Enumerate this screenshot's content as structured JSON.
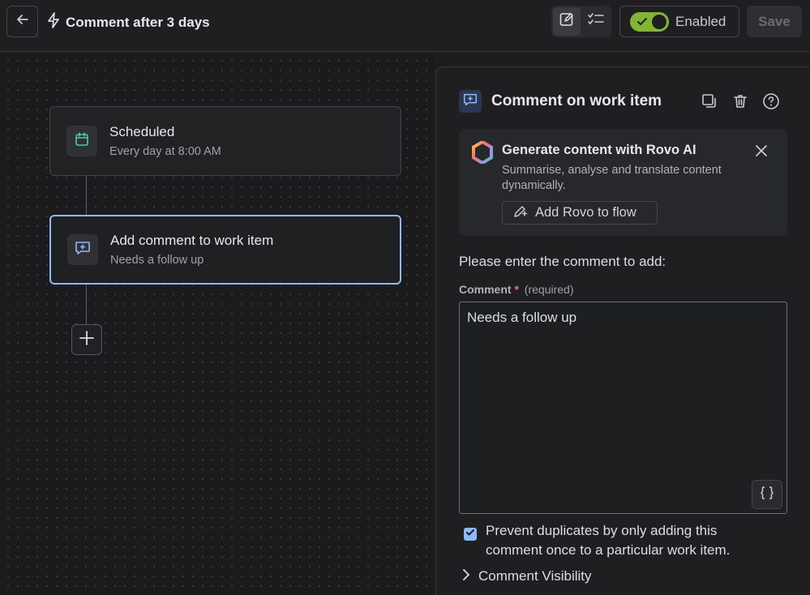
{
  "header": {
    "title": "Comment after 3 days",
    "enabled_label": "Enabled",
    "save_label": "Save",
    "toggle_on": true
  },
  "flow": {
    "nodes": [
      {
        "title": "Scheduled",
        "subtitle": "Every day at 8:00 AM",
        "icon": "calendar-icon",
        "color": "#4bce97"
      },
      {
        "title": "Add comment to work item",
        "subtitle": "Needs a follow up",
        "icon": "comment-add-icon",
        "color": "#8fb8f6"
      }
    ]
  },
  "panel": {
    "title": "Comment on work item",
    "rovo": {
      "title": "Generate content with Rovo AI",
      "description": "Summarise, analyse and translate content dynamically.",
      "button_label": "Add Rovo to flow"
    },
    "prompt": "Please enter the comment to add:",
    "field_label": "Comment",
    "required_mark": "*",
    "required_text": "(required)",
    "comment_value": "Needs a follow up",
    "prevent_duplicates_label": "Prevent duplicates by only adding this comment once to a particular work item.",
    "prevent_duplicates_checked": true,
    "visibility_label": "Comment Visibility"
  },
  "colors": {
    "accent": "#8fb8f6",
    "toggle_on": "#82b536",
    "required": "#f87168"
  }
}
